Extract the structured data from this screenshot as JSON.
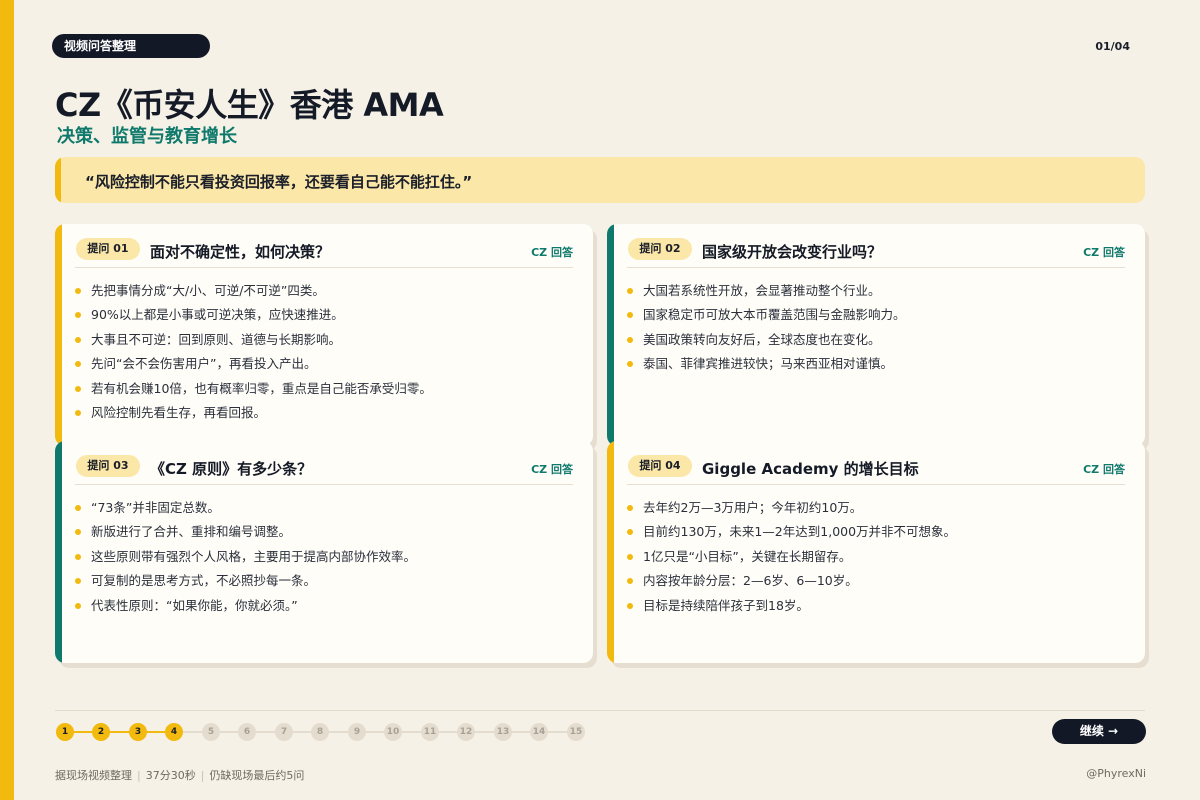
{
  "header": {
    "tag": "视频问答整理",
    "page_indicator": "01/04",
    "title": "CZ《币安人生》香港 AMA",
    "subtitle": "决策、监管与教育增长"
  },
  "quote": "“风险控制不能只看投资回报率，还要看自己能不能扛住。”",
  "cards": [
    {
      "badge": "提问 01",
      "title": "面对不确定性，如何决策？",
      "answer_label": "CZ 回答",
      "accent": "#f2b90f",
      "bullets": [
        "先把事情分成“大/小、可逆/不可逆”四类。",
        "90%以上都是小事或可逆决策，应快速推进。",
        "大事且不可逆：回到原则、道德与长期影响。",
        "先问“会不会伤害用户”，再看投入产出。",
        "若有机会赚10倍，也有概率归零，重点是自己能否承受归零。",
        "风险控制先看生存，再看回报。"
      ]
    },
    {
      "badge": "提问 02",
      "title": "国家级开放会改变行业吗？",
      "answer_label": "CZ 回答",
      "accent": "#0f7a6c",
      "bullets": [
        "大国若系统性开放，会显著推动整个行业。",
        "国家稳定币可放大本币覆盖范围与金融影响力。",
        "美国政策转向友好后，全球态度也在变化。",
        "泰国、菲律宾推进较快；马来西亚相对谨慎。"
      ]
    },
    {
      "badge": "提问 03",
      "title": "《CZ 原则》有多少条？",
      "answer_label": "CZ 回答",
      "accent": "#0f7a6c",
      "bullets": [
        "“73条”并非固定总数。",
        "新版进行了合并、重排和编号调整。",
        "这些原则带有强烈个人风格，主要用于提高内部协作效率。",
        "可复制的是思考方式，不必照抄每一条。",
        "代表性原则：“如果你能，你就必须。”"
      ]
    },
    {
      "badge": "提问 04",
      "title": "Giggle Academy 的增长目标",
      "answer_label": "CZ 回答",
      "accent": "#f2b90f",
      "bullets": [
        "去年约2万—3万用户；今年初约10万。",
        "目前约130万，未来1—2年达到1,000万并非不可想象。",
        "1亿只是“小目标”，关键在长期留存。",
        "内容按年龄分层：2—6岁、6—10岁。",
        "目标是持续陪伴孩子到18岁。"
      ]
    }
  ],
  "progress": {
    "steps": [
      "1",
      "2",
      "3",
      "4",
      "5",
      "6",
      "7",
      "8",
      "9",
      "10",
      "11",
      "12",
      "13",
      "14",
      "15"
    ],
    "completed": 4
  },
  "continue_label": "继续 →",
  "footer": {
    "source": "据现场视频整理",
    "duration": "37分30秒",
    "note": "仍缺现场最后约5问",
    "handle": "@PhyrexNi"
  },
  "colors": {
    "accent_yellow": "#f2b90f",
    "accent_teal": "#0f7a6c",
    "dark": "#121826",
    "background": "#f6f1e7"
  }
}
